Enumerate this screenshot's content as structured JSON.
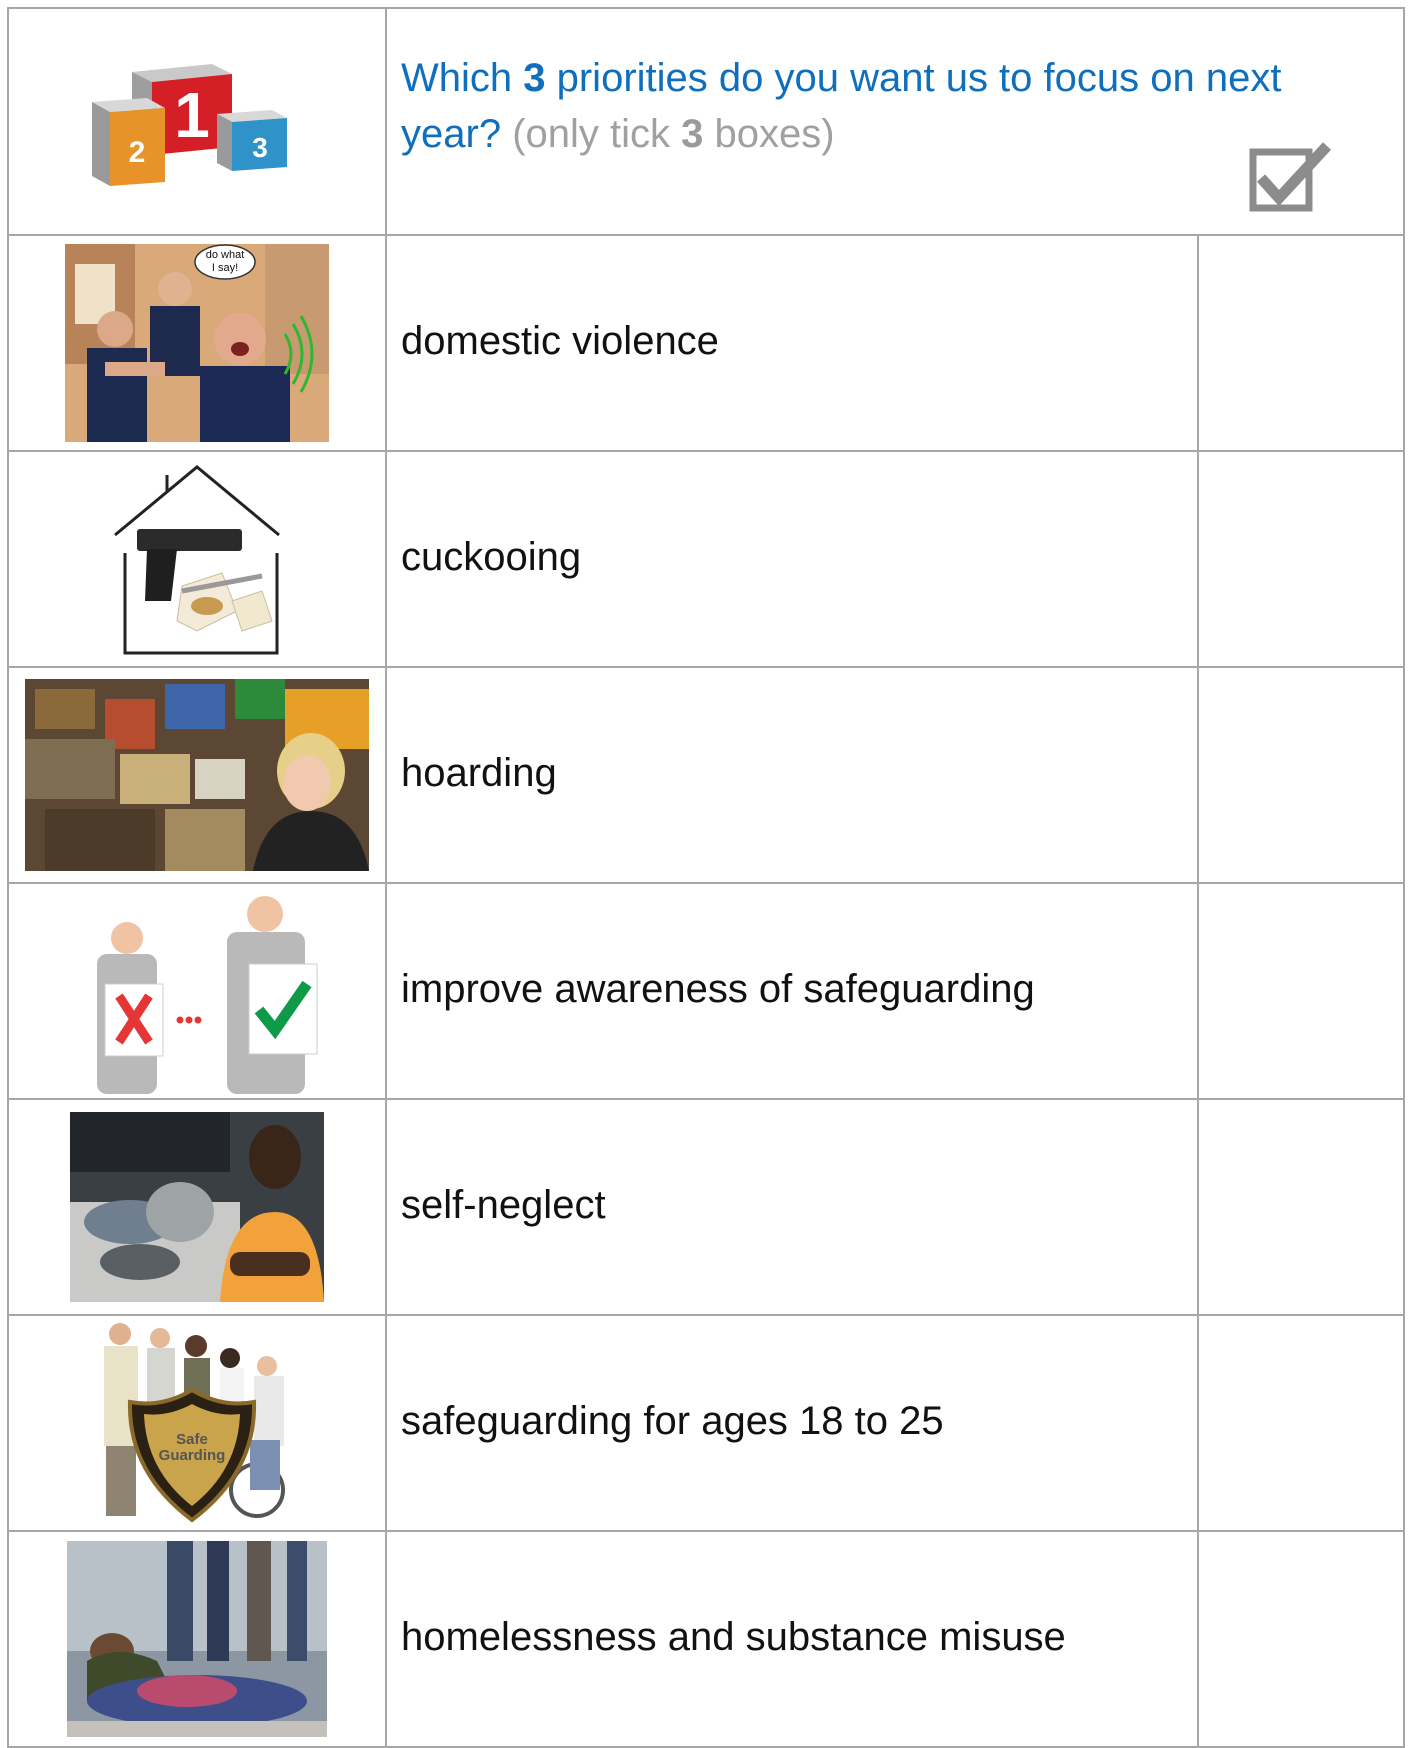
{
  "header": {
    "question_part1": "Which ",
    "question_num": "3",
    "question_part2": " priorities do you want us to focus on next year?",
    "hint_part1": "(only tick ",
    "hint_num": "3",
    "hint_part2": " boxes)",
    "podium_labels": [
      "2",
      "1",
      "3"
    ],
    "speech_bubble": "do what I say!"
  },
  "items": [
    {
      "label": "domestic violence",
      "icon": "domestic-violence-illustration"
    },
    {
      "label": "cuckooing",
      "icon": "house-gun-syringe-illustration"
    },
    {
      "label": "hoarding",
      "icon": "hoarding-clutter-illustration"
    },
    {
      "label": "improve awareness of safeguarding",
      "icon": "wrong-to-right-illustration"
    },
    {
      "label": "self-neglect",
      "icon": "dirty-dishes-illustration"
    },
    {
      "label": "safeguarding for ages 18 to 25",
      "icon": "safeguarding-shield-group-illustration"
    },
    {
      "label": "homelessness and substance misuse",
      "icon": "homeless-person-illustration"
    }
  ],
  "shield_text": [
    "Safe",
    "Guarding"
  ],
  "colors": {
    "question_blue": "#0f6fbd",
    "hint_grey": "#a0a0a0",
    "border": "#a6a6a6"
  }
}
